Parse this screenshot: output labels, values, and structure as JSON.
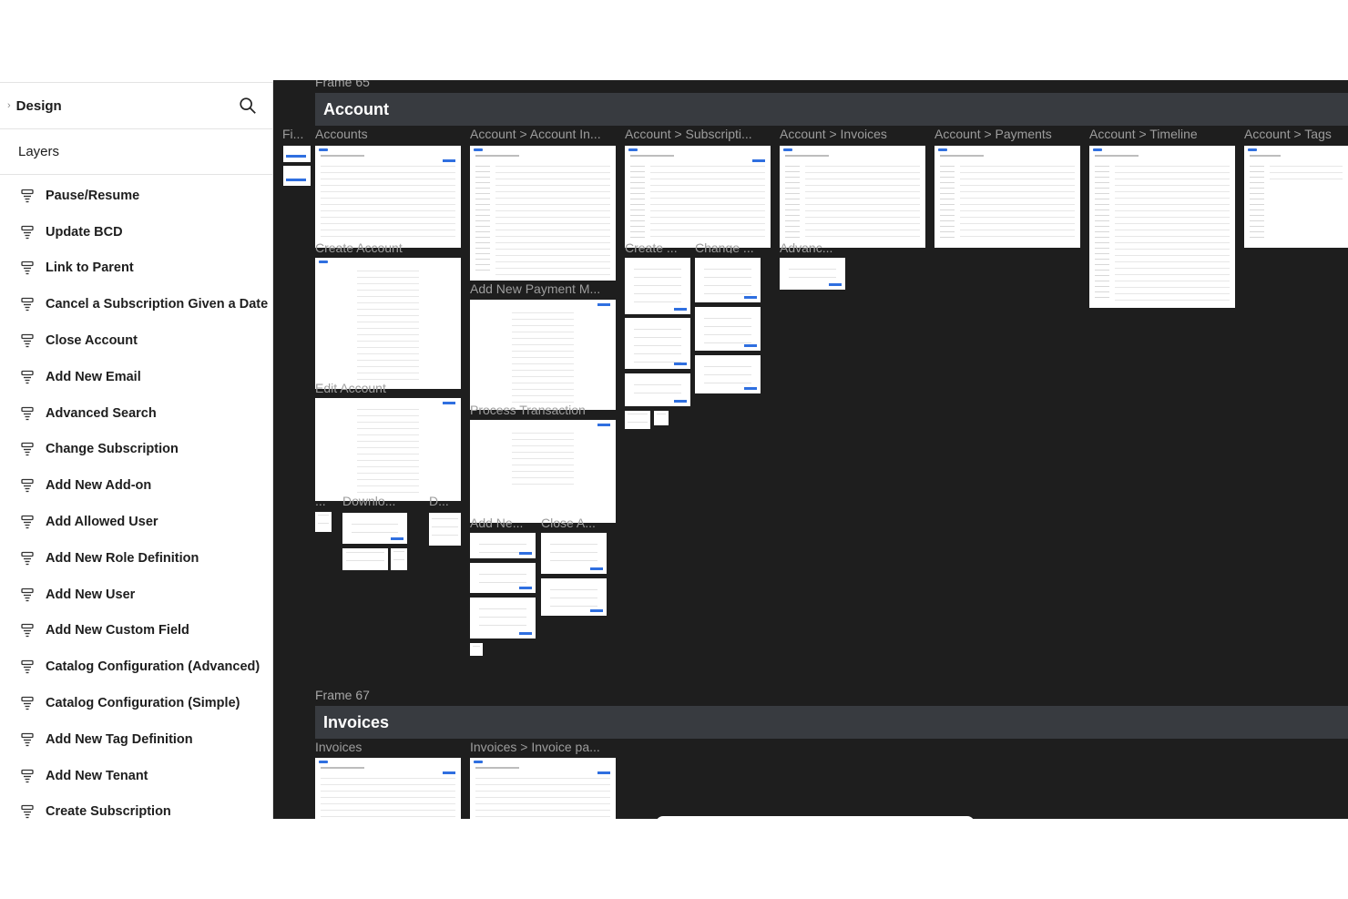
{
  "sidebar": {
    "title": "Design",
    "collapse_icon": "chevron-right-icon",
    "search_icon": "search-icon",
    "layers_label": "Layers",
    "items": [
      {
        "label": "Pause/Resume"
      },
      {
        "label": "Update BCD"
      },
      {
        "label": "Link to Parent"
      },
      {
        "label": "Cancel a Subscription Given a Date"
      },
      {
        "label": "Close Account"
      },
      {
        "label": "Add New Email"
      },
      {
        "label": "Advanced Search"
      },
      {
        "label": "Change Subscription"
      },
      {
        "label": "Add New Add-on"
      },
      {
        "label": "Add Allowed User"
      },
      {
        "label": "Add New Role Definition"
      },
      {
        "label": "Add New User"
      },
      {
        "label": "Add New Custom Field"
      },
      {
        "label": "Catalog Configuration (Advanced)"
      },
      {
        "label": "Catalog Configuration (Simple)"
      },
      {
        "label": "Add New Tag Definition"
      },
      {
        "label": "Add New Tenant"
      },
      {
        "label": "Create Subscription"
      }
    ]
  },
  "canvas": {
    "background": "#1e1e1e",
    "frame_65": {
      "label": "Frame 65",
      "section_title": "Account",
      "artboard_labels": {
        "fi": "Fi...",
        "accounts": "Accounts",
        "account_info": "Account > Account In...",
        "subscriptions": "Account > Subscripti...",
        "invoices": "Account > Invoices",
        "payments": "Account > Payments",
        "timeline": "Account > Timeline",
        "tags": "Account > Tags",
        "create_account": "Create Account",
        "add_payment": "Add New Payment M...",
        "create_short": "Create ...",
        "change_short": "Change ...",
        "advanced_short": "Advanc...",
        "edit_account": "Edit Account",
        "process_transaction": "Process Transaction",
        "dots": "...",
        "download": "Downlo...",
        "d_short": "D...",
        "add_new_short": "Add Ne...",
        "close_short": "Close A..."
      }
    },
    "frame_67": {
      "label": "Frame 67",
      "section_title": "Invoices",
      "artboard_labels": {
        "invoices": "Invoices",
        "invoice_page": "Invoices > Invoice pa..."
      }
    }
  }
}
